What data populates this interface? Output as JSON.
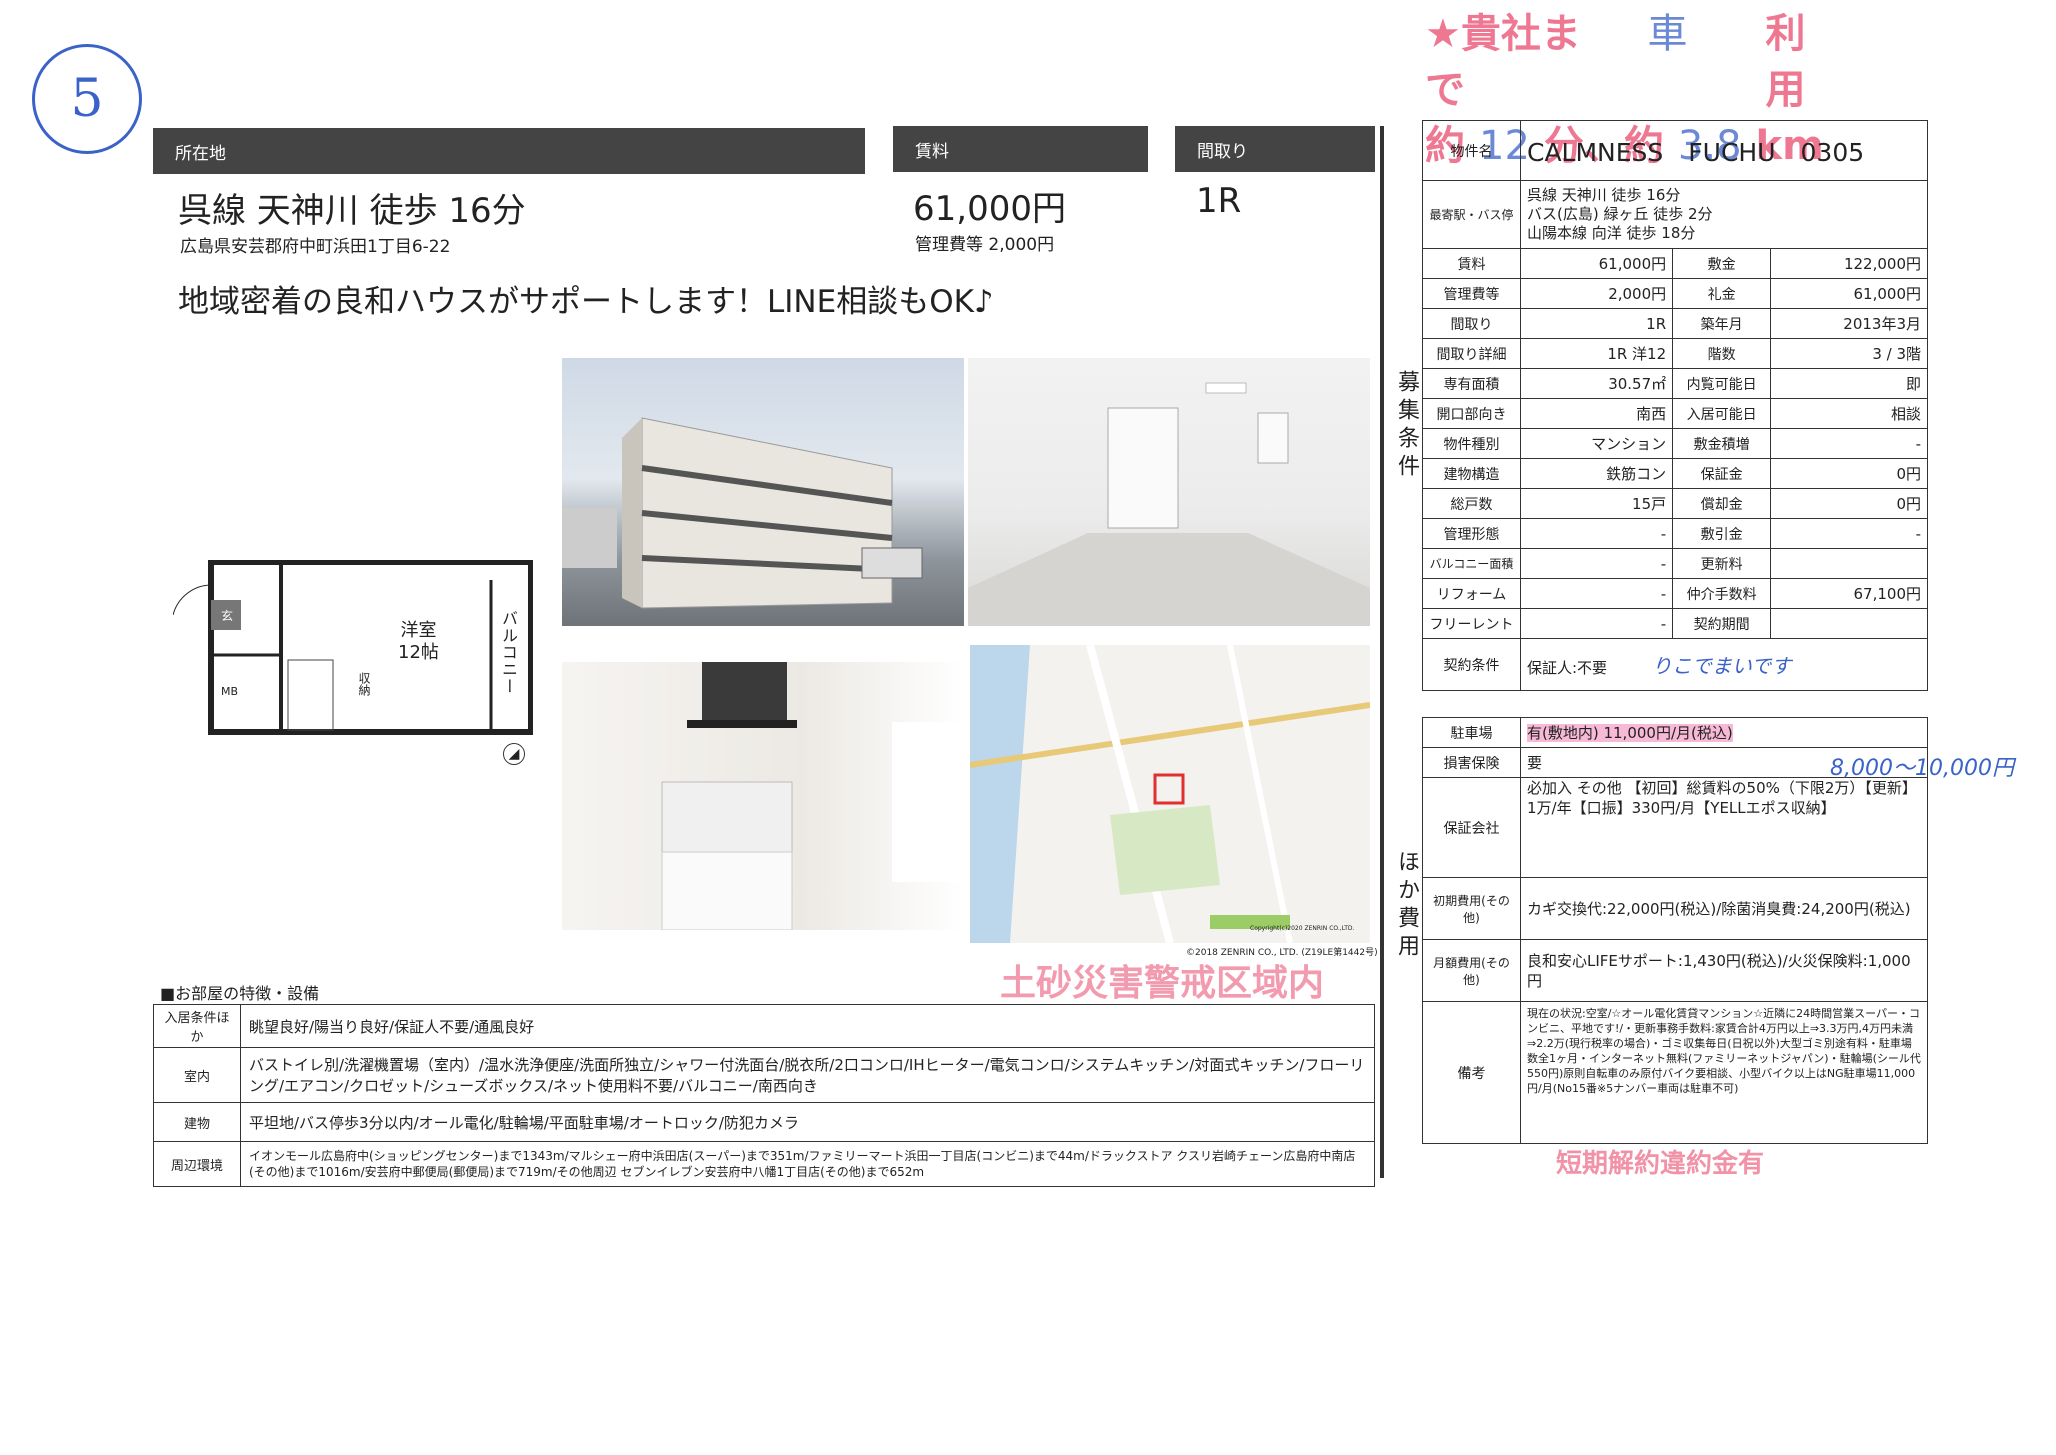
{
  "annotations": {
    "circled_number": "5",
    "top_stamp_line1_a": "★貴社まで",
    "top_stamp_line1_b": "車",
    "top_stamp_line1_c": "利用",
    "top_stamp_line2_a": "約",
    "top_stamp_line2_b": "12",
    "top_stamp_line2_c": "分、約",
    "top_stamp_line2_d": "3.8",
    "top_stamp_line2_e": "km",
    "handwritten_contract_note": "りこでまいです",
    "handwritten_insurance_note": "8,000〜10,000円",
    "disaster_stamp": "土砂災害警戒区域内",
    "early_cancel_stamp": "短期解約違約金有"
  },
  "header": {
    "location_label": "所在地",
    "rent_label": "賃料",
    "layout_label": "間取り",
    "access": "呉線 天神川 徒歩 16分",
    "address": "広島県安芸郡府中町浜田1丁目6-22",
    "rent": "61,000円",
    "mgmt_fee": "管理費等 2,000円",
    "layout": "1R",
    "catchphrase": "地域密着の良和ハウスがサポートします！LINE相談もOK♪"
  },
  "floorplan": {
    "room": "洋室",
    "room_size": "12帖",
    "balcony": "バルコニー",
    "entrance": "玄",
    "mb": "MB",
    "storage": "収納"
  },
  "map": {
    "copyright1": "Copyright(c)2020 ZENRIN CO.,LTD.",
    "copyright2": "©2018 ZENRIN CO., LTD. (Z19LE第1442号)"
  },
  "features": {
    "heading": "■お部屋の特徴・設備",
    "rows": [
      {
        "label": "入居条件ほか",
        "value": "眺望良好/陽当り良好/保証人不要/通風良好"
      },
      {
        "label": "室内",
        "value": "バストイレ別/洗濯機置場（室内）/温水洗浄便座/洗面所独立/シャワー付洗面台/脱衣所/2口コンロ/IHヒーター/電気コンロ/システムキッチン/対面式キッチン/フローリング/エアコン/クロゼット/シューズボックス/ネット使用料不要/バルコニー/南西向き"
      },
      {
        "label": "建物",
        "value": "平坦地/バス停歩3分以内/オール電化/駐輪場/平面駐車場/オートロック/防犯カメラ"
      },
      {
        "label": "周辺環境",
        "value": "イオンモール広島府中(ショッピングセンター)まで1343m/マルシェー府中浜田店(スーパー)まで351m/ファミリーマート浜田一丁目店(コンビニ)まで44m/ドラックストア クスリ岩崎チェーン広島府中南店(その他)まで1016m/安芸府中郵便局(郵便局)まで719m/その他周辺 セブンイレブン安芸府中八幡1丁目店(その他)まで652m"
      }
    ]
  },
  "right": {
    "section1_label": "募集条件",
    "section2_label": "ほか費用",
    "property_name_label": "物件名",
    "property_name": "CALMNESS　FUCHU　0305",
    "station_label": "最寄駅・バス停",
    "station_lines": [
      "呉線 天神川 徒歩 16分",
      "バス(広島) 緑ヶ丘 徒歩 2分",
      "山陽本線 向洋 徒歩 18分"
    ],
    "grid": [
      [
        "賃料",
        "61,000円",
        "敷金",
        "122,000円"
      ],
      [
        "管理費等",
        "2,000円",
        "礼金",
        "61,000円"
      ],
      [
        "間取り",
        "1R",
        "築年月",
        "2013年3月"
      ],
      [
        "間取り詳細",
        "1R 洋12",
        "階数",
        "3 / 3階"
      ],
      [
        "専有面積",
        "30.57㎡",
        "内覧可能日",
        "即"
      ],
      [
        "開口部向き",
        "南西",
        "入居可能日",
        "相談"
      ],
      [
        "物件種別",
        "マンション",
        "敷金積増",
        "-"
      ],
      [
        "建物構造",
        "鉄筋コン",
        "保証金",
        "0円"
      ],
      [
        "総戸数",
        "15戸",
        "償却金",
        "0円"
      ],
      [
        "管理形態",
        "-",
        "敷引金",
        "-"
      ],
      [
        "バルコニー面積",
        "-",
        "更新料",
        ""
      ],
      [
        "リフォーム",
        "-",
        "仲介手数料",
        "67,100円"
      ],
      [
        "フリーレント",
        "-",
        "契約期間",
        ""
      ]
    ],
    "contract_label": "契約条件",
    "contract_value": "保証人:不要",
    "parking_label": "駐車場",
    "parking_value": "有(敷地内) 11,000円/月(税込)",
    "insurance_label": "損害保険",
    "insurance_value": "要",
    "guarantor_label": "保証会社",
    "guarantor_value": "必加入 その他 【初回】総賃料の50%（下限2万）【更新】1万/年【口振】330円/月【YELLエポス収納】",
    "initial_label": "初期費用(その他)",
    "initial_value": "カギ交換代:22,000円(税込)/除菌消臭費:24,200円(税込)",
    "monthly_label": "月額費用(その他)",
    "monthly_value": "良和安心LIFEサポート:1,430円(税込)/火災保険料:1,000円",
    "remarks_label": "備考",
    "remarks_value": "現在の状況:空室/☆オール電化賃貸マンション☆近隣に24時間営業スーパー・コンビニ、平地です!/・更新事務手数料:家賃合計4万円以上⇒3.3万円,4万円未満⇒2.2万(現行税率の場合)・ゴミ収集毎日(日祝以外)大型ゴミ別途有料・駐車場数全1ヶ月・インターネット無料(ファミリーネットジャパン)・駐輪場(シール代550円)原則自転車のみ原付バイク要相談、小型バイク以上はNG駐車場11,000円/月(No15番※5ナンバー車両は駐車不可)"
  }
}
